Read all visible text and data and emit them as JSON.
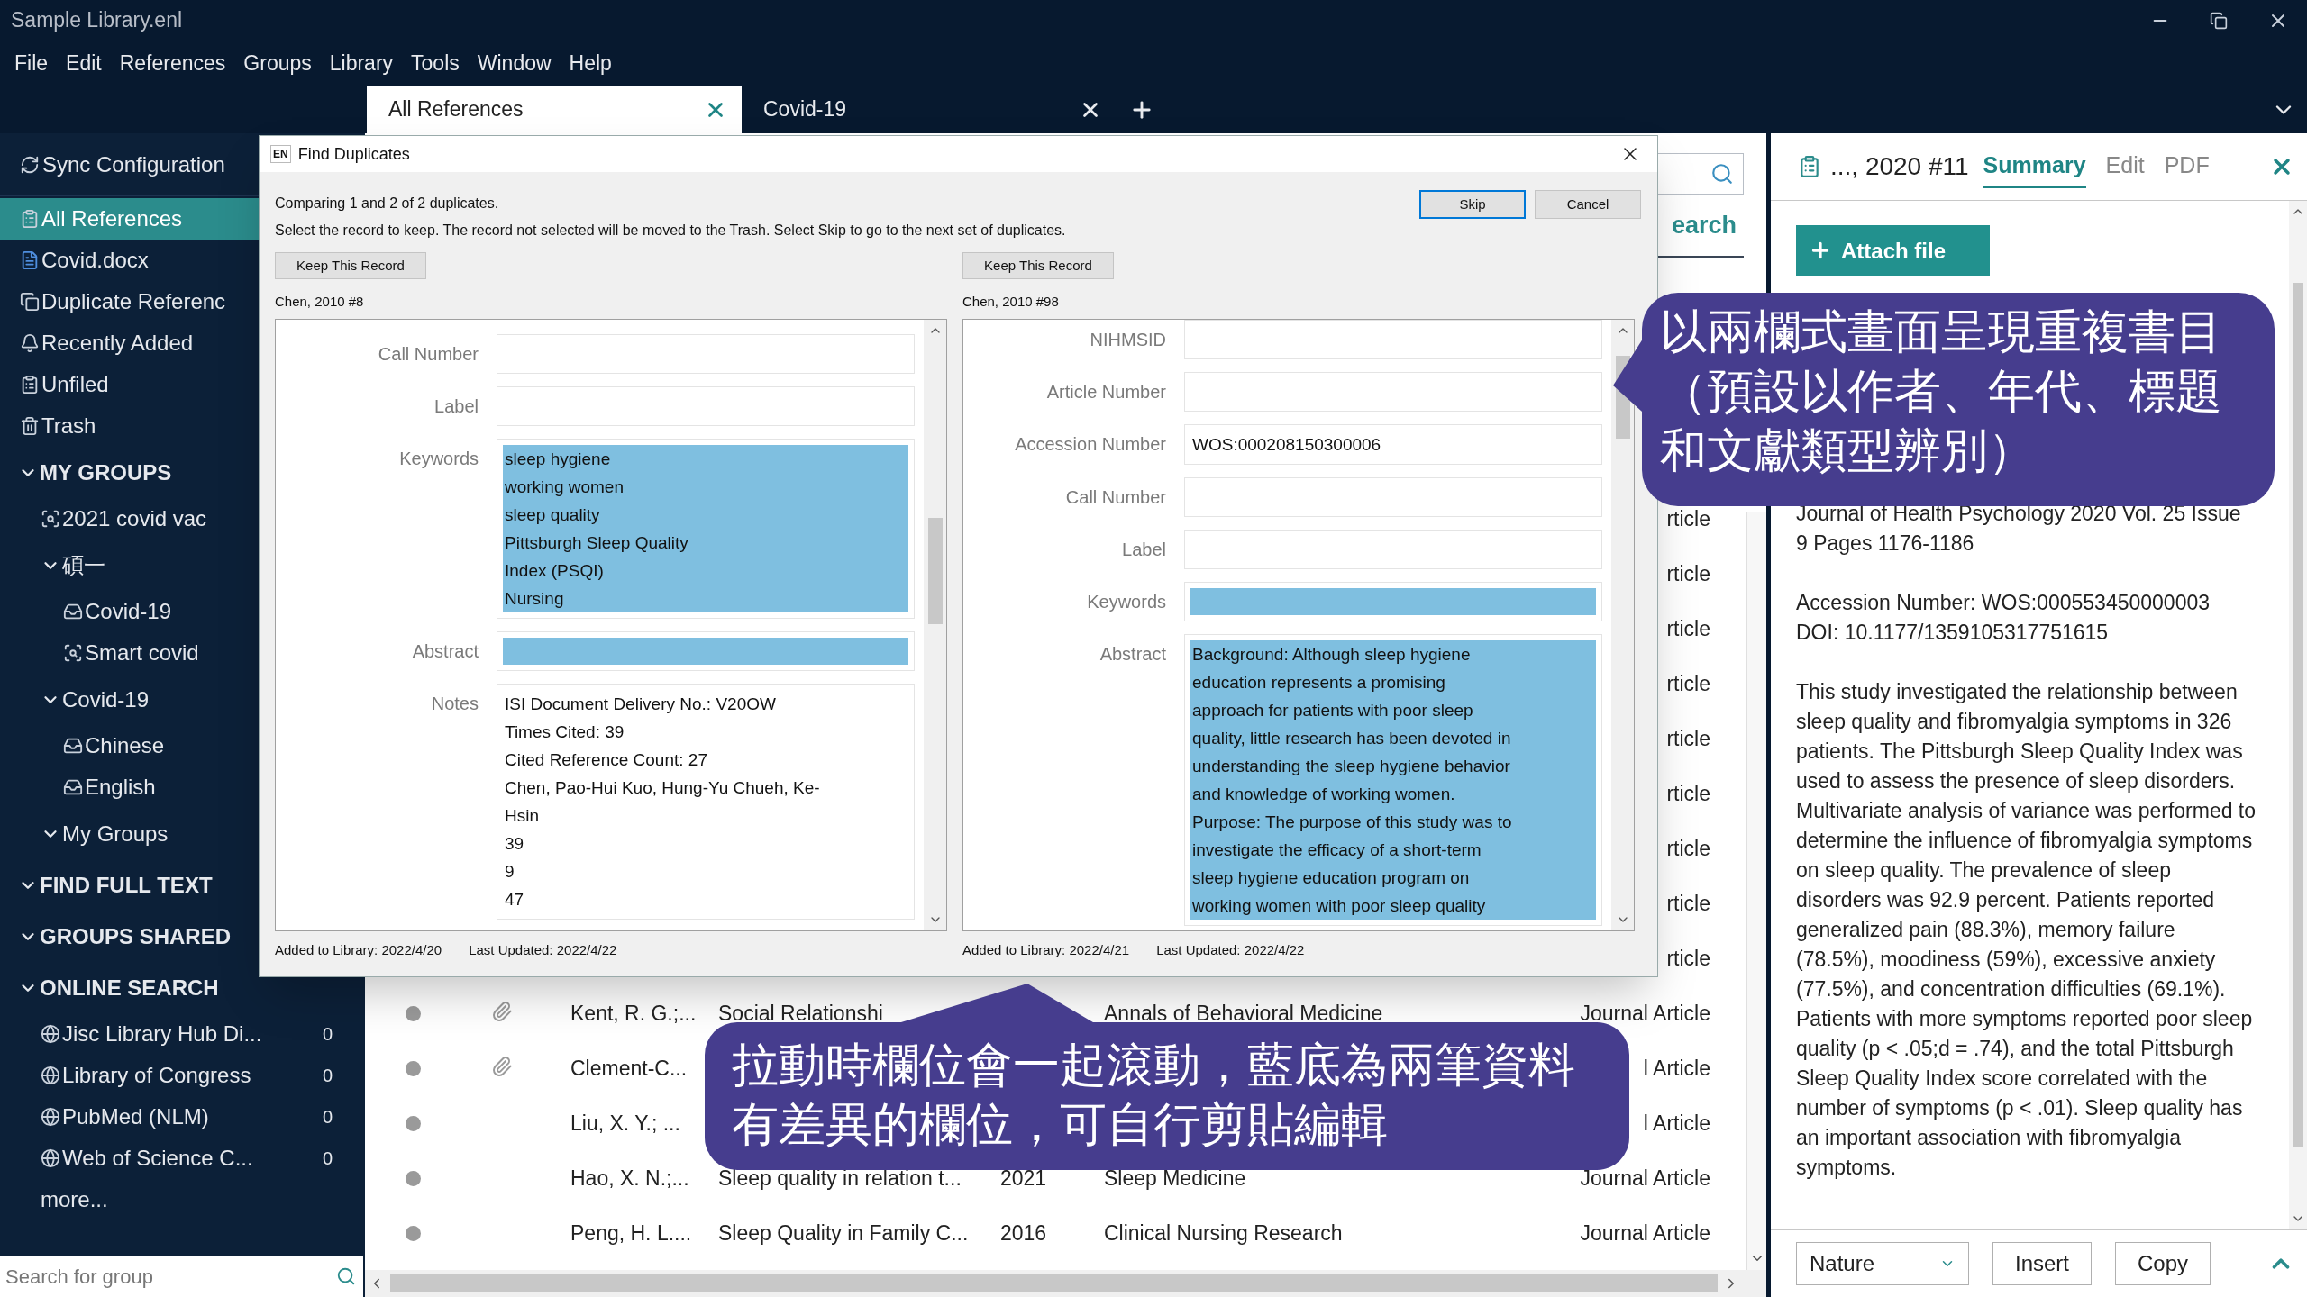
{
  "window": {
    "title": "Sample Library.enl"
  },
  "menu": [
    "File",
    "Edit",
    "References",
    "Groups",
    "Library",
    "Tools",
    "Window",
    "Help"
  ],
  "tabs": [
    {
      "label": "All References",
      "selected": true
    },
    {
      "label": "Covid-19",
      "selected": false
    }
  ],
  "sidebar": {
    "sync_label": "Sync Configuration",
    "library_items": [
      {
        "label": "All References",
        "kind": "clipboard",
        "selected": true
      },
      {
        "label": "Covid.docx",
        "kind": "word",
        "selected": false
      },
      {
        "label": "Duplicate Referenc",
        "kind": "duplicate",
        "selected": false
      },
      {
        "label": "Recently Added",
        "kind": "bell",
        "selected": false
      },
      {
        "label": "Unfiled",
        "kind": "clipboard",
        "selected": false
      },
      {
        "label": "Trash",
        "kind": "trash",
        "selected": false
      }
    ],
    "sections": [
      {
        "label": "MY GROUPS",
        "expanded": true,
        "children": [
          {
            "label": "2021 covid vac",
            "kind": "smart"
          },
          {
            "label": "碩一",
            "kind": "set",
            "expanded": true,
            "children": [
              {
                "label": "Covid-19",
                "kind": "group"
              },
              {
                "label": "Smart covid",
                "kind": "smart"
              }
            ]
          },
          {
            "label": "Covid-19",
            "kind": "set",
            "expanded": true,
            "children": [
              {
                "label": "Chinese",
                "kind": "group"
              },
              {
                "label": "English",
                "kind": "group"
              }
            ]
          },
          {
            "label": "My Groups",
            "kind": "set",
            "expanded": true
          }
        ]
      },
      {
        "label": "FIND FULL TEXT",
        "expanded": true
      },
      {
        "label": "GROUPS SHARED",
        "expanded": true
      },
      {
        "label": "ONLINE SEARCH",
        "expanded": true,
        "children": [
          {
            "label": "Jisc Library Hub Di...",
            "kind": "online",
            "count": "0"
          },
          {
            "label": "Library of Congress",
            "kind": "online",
            "count": "0"
          },
          {
            "label": "PubMed (NLM)",
            "kind": "online",
            "count": "0"
          },
          {
            "label": "Web of Science C...",
            "kind": "online",
            "count": "0"
          }
        ]
      }
    ],
    "more": "more...",
    "search": {
      "placeholder": "Search for group"
    }
  },
  "main": {
    "search_tab": "earch",
    "rows": [
      {
        "type": "rticle"
      },
      {
        "type": "rticle"
      },
      {
        "type": "rticle"
      },
      {
        "type": "rticle"
      },
      {
        "type": "rticle"
      },
      {
        "type": "rticle"
      },
      {
        "type": "rticle"
      },
      {
        "type": "rticle"
      },
      {
        "type": "rticle"
      },
      {
        "author": "Kent, R. G.;...",
        "title": "Social Relationshi",
        "journal": "Annals of Behavioral Medicine",
        "type": "Journal Article",
        "attachment": true
      },
      {
        "author": "Clement-C...",
        "type": "l Article",
        "attachment": true
      },
      {
        "author": "Liu, X. Y.; ...",
        "type": "l Article",
        "attachment": false
      },
      {
        "author": "Hao, X. N.;...",
        "title": "Sleep quality in relation t...",
        "year": "2021",
        "journal": "Sleep Medicine",
        "type": "Journal Article",
        "attachment": false
      },
      {
        "author": "Peng, H. L....",
        "title": "Sleep Quality in Family C...",
        "year": "2016",
        "journal": "Clinical Nursing Research",
        "type": "Journal Article",
        "attachment": false
      }
    ]
  },
  "dialog": {
    "lang_badge": "EN",
    "title": "Find Duplicates",
    "status": "Comparing 1 and 2 of 2 duplicates.",
    "instructions": "Select the record to keep. The record not selected will be moved to the Trash. Select Skip to go to the next set of duplicates.",
    "buttons": [
      {
        "label": "Skip",
        "default": true
      },
      {
        "label": "Cancel",
        "default": false
      }
    ],
    "records": [
      {
        "keep_button": "Keep This Record",
        "heading": "Chen, 2010 #8",
        "fields": [
          {
            "label": "Call Number",
            "differs": false
          },
          {
            "label": "Label",
            "differs": false
          },
          {
            "label": "Keywords",
            "differs": true,
            "lines": [
              "sleep hygiene",
              "working women",
              "sleep quality",
              "Pittsburgh Sleep Quality",
              "Index (PSQI)",
              "Nursing"
            ]
          },
          {
            "label": "Abstract",
            "differs": true
          },
          {
            "label": "Notes",
            "differs": false,
            "lines": [
              "ISI Document Delivery No.: V20OW",
              "Times Cited: 39",
              "Cited Reference Count: 27",
              "Chen, Pao-Hui Kuo, Hung-Yu Chueh, Ke-",
              "Hsin",
              "39",
              "9",
              "47"
            ]
          }
        ],
        "added": "Added to Library: 2022/4/20",
        "updated": "Last Updated: 2022/4/22"
      },
      {
        "keep_button": "Keep This Record",
        "heading": "Chen, 2010 #98",
        "fields": [
          {
            "label": "NIHMSID",
            "differs": false
          },
          {
            "label": "Article Number",
            "differs": false
          },
          {
            "label": "Accession Number",
            "differs": false,
            "lines": [
              "WOS:000208150300006"
            ]
          },
          {
            "label": "Call Number",
            "differs": false
          },
          {
            "label": "Label",
            "differs": false
          },
          {
            "label": "Keywords",
            "differs": true
          },
          {
            "label": "Abstract",
            "differs": true,
            "lines": [
              "Background: Although sleep hygiene",
              "education represents a promising",
              "approach for patients with poor sleep",
              "quality, little research has been devoted in",
              "understanding the sleep hygiene behavior",
              "and knowledge of working women.",
              "Purpose: The purpose of this study was to",
              "investigate the efficacy of a short-term",
              "sleep hygiene education program on",
              "working women with poor sleep quality"
            ]
          }
        ],
        "added": "Added to Library: 2022/4/21",
        "updated": "Last Updated: 2022/4/22"
      }
    ]
  },
  "reference_panel": {
    "title": "..., 2020 #11",
    "tabs": [
      {
        "label": "Summary",
        "selected": true
      },
      {
        "label": "Edit",
        "selected": false
      },
      {
        "label": "PDF",
        "selected": false
      }
    ],
    "attach_button": "Attach file",
    "source": "Journal of Health Psychology 2020 Vol. 25 Issue 9 Pages 1176-1186",
    "accession": "Accession Number: WOS:000553450000003",
    "doi": "DOI: 10.1177/1359105317751615",
    "abstract": "This study investigated the relationship between sleep quality and fibromyalgia symptoms in 326 patients. The Pittsburgh Sleep Quality Index was used to assess the presence of sleep disorders. Multivariate analysis of variance was performed to determine the influence of fibromyalgia symptoms on sleep quality. The prevalence of sleep disorders was 92.9 percent. Patients reported generalized pain (88.3%), memory failure (78.5%), moodiness (59%), excessive anxiety (77.5%), and concentration difficulties (69.1%). Patients with more symptoms reported poor sleep quality (p < .05;d = .74), and the total Pittsburgh Sleep Quality Index score correlated with the number of symptoms (p < .01). Sleep quality has an important association with fibromyalgia symptoms.",
    "style_select": "Nature",
    "buttons": [
      "Insert",
      "Copy"
    ]
  },
  "callouts": [
    {
      "lines": [
        "以兩欄式畫面呈現重複書目",
        "（預設以作者、年代、標題",
        "和文獻類型辨別）"
      ]
    },
    {
      "lines": [
        "拉動時欄位會一起滾動，藍底為兩筆資料",
        "有差異的欄位，可自行剪貼編輯"
      ]
    }
  ]
}
